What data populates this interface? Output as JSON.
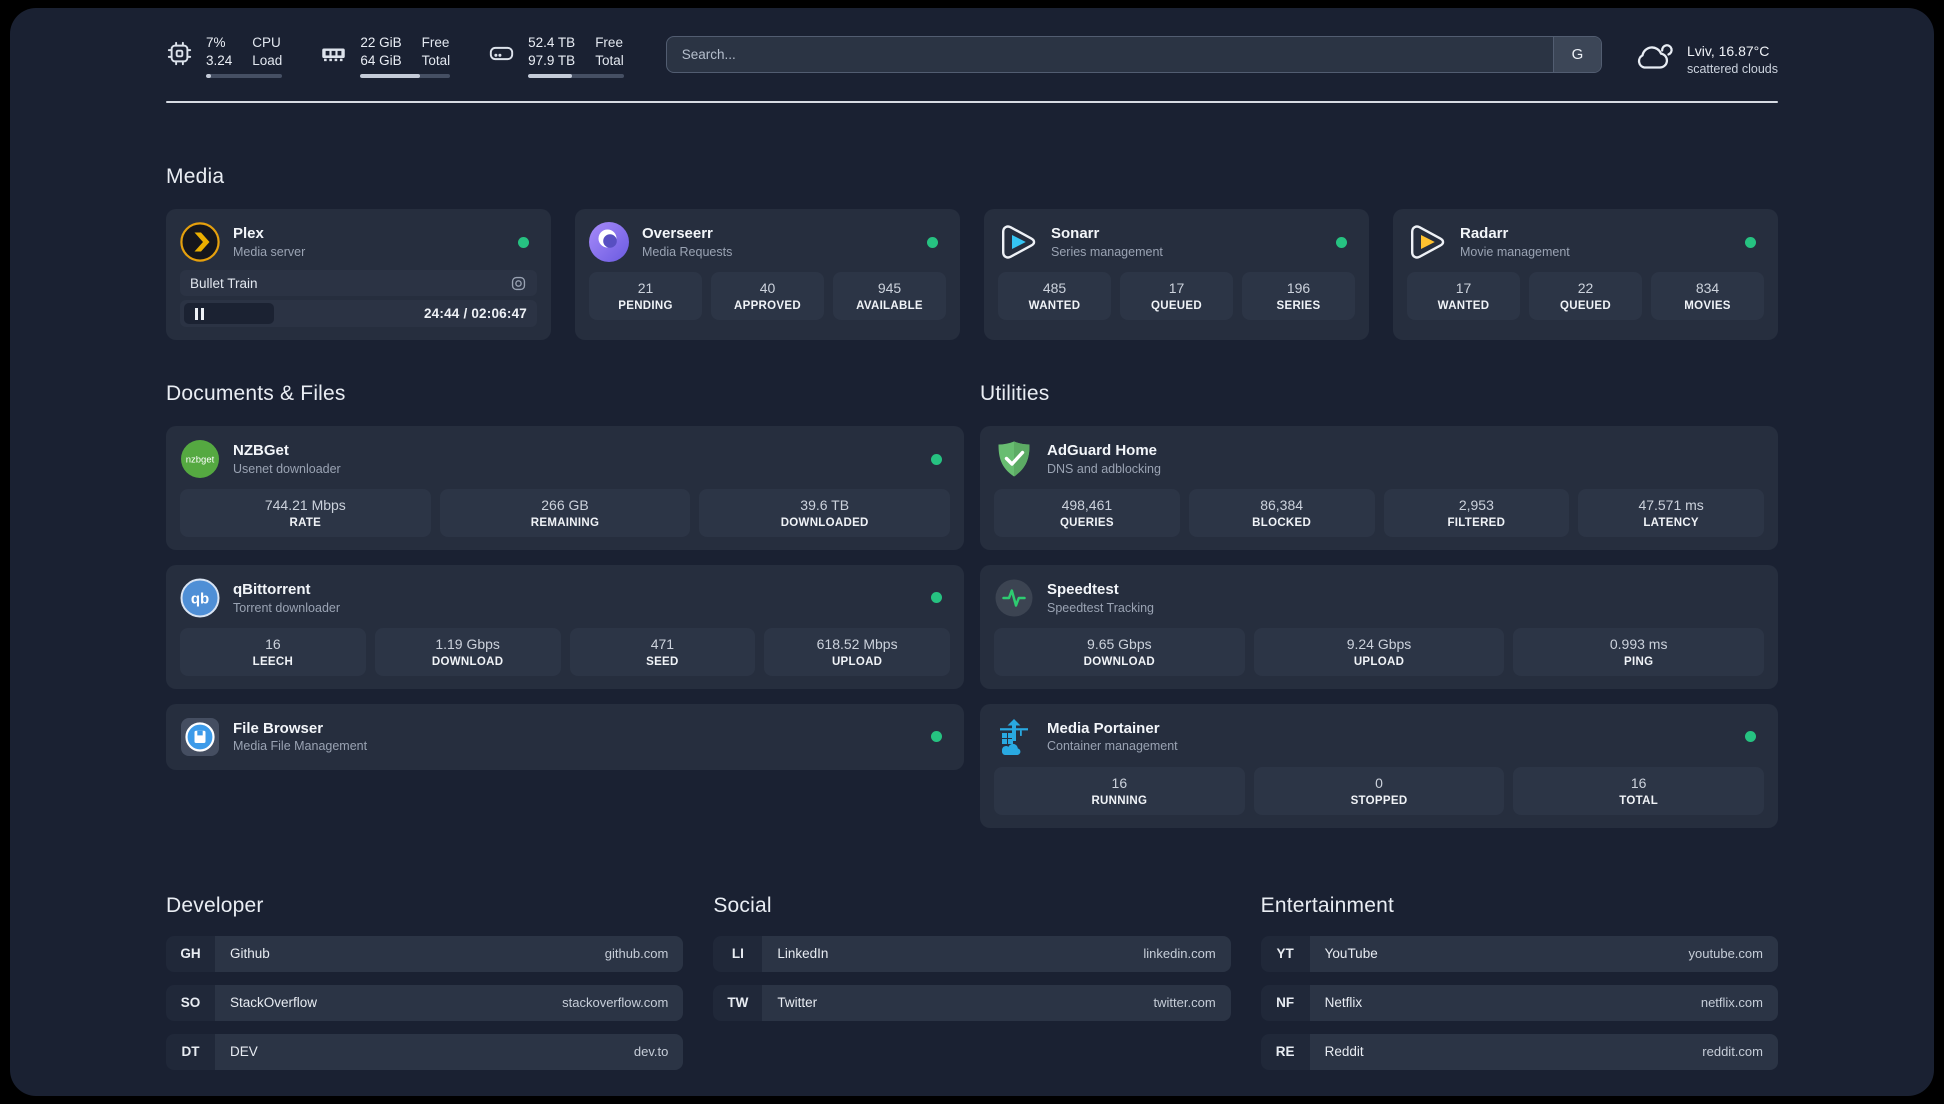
{
  "topbar": {
    "cpu": {
      "percent": "7%",
      "load": "3.24",
      "label_top": "CPU",
      "label_bottom": "Load",
      "bar_style": "width:7%"
    },
    "memory": {
      "free": "22 GiB",
      "total": "64 GiB",
      "label_top": "Free",
      "label_bottom": "Total",
      "bar_style": "width:66%"
    },
    "disk": {
      "free": "52.4 TB",
      "total": "97.9 TB",
      "label_top": "Free",
      "label_bottom": "Total",
      "bar_style": "width:46%"
    },
    "search": {
      "placeholder": "Search...",
      "engine": "G"
    },
    "weather": {
      "location": "Lviv, 16.87°C",
      "condition": "scattered clouds"
    }
  },
  "media": {
    "title": "Media",
    "plex": {
      "name": "Plex",
      "description": "Media server",
      "now_playing": "Bullet Train",
      "time": "24:44 / 02:06:47"
    },
    "overseerr": {
      "name": "Overseerr",
      "description": "Media Requests",
      "stats": [
        {
          "value": "21",
          "label": "PENDING"
        },
        {
          "value": "40",
          "label": "APPROVED"
        },
        {
          "value": "945",
          "label": "AVAILABLE"
        }
      ]
    },
    "sonarr": {
      "name": "Sonarr",
      "description": "Series management",
      "stats": [
        {
          "value": "485",
          "label": "WANTED"
        },
        {
          "value": "17",
          "label": "QUEUED"
        },
        {
          "value": "196",
          "label": "SERIES"
        }
      ]
    },
    "radarr": {
      "name": "Radarr",
      "description": "Movie management",
      "stats": [
        {
          "value": "17",
          "label": "WANTED"
        },
        {
          "value": "22",
          "label": "QUEUED"
        },
        {
          "value": "834",
          "label": "MOVIES"
        }
      ]
    }
  },
  "documents": {
    "title": "Documents & Files",
    "nzbget": {
      "name": "NZBGet",
      "description": "Usenet downloader",
      "stats": [
        {
          "value": "744.21 Mbps",
          "label": "RATE"
        },
        {
          "value": "266 GB",
          "label": "REMAINING"
        },
        {
          "value": "39.6 TB",
          "label": "DOWNLOADED"
        }
      ]
    },
    "qbittorrent": {
      "name": "qBittorrent",
      "description": "Torrent downloader",
      "stats": [
        {
          "value": "16",
          "label": "LEECH"
        },
        {
          "value": "1.19 Gbps",
          "label": "DOWNLOAD"
        },
        {
          "value": "471",
          "label": "SEED"
        },
        {
          "value": "618.52 Mbps",
          "label": "UPLOAD"
        }
      ]
    },
    "filebrowser": {
      "name": "File Browser",
      "description": "Media File Management"
    }
  },
  "utilities": {
    "title": "Utilities",
    "adguard": {
      "name": "AdGuard Home",
      "description": "DNS and adblocking",
      "stats": [
        {
          "value": "498,461",
          "label": "QUERIES"
        },
        {
          "value": "86,384",
          "label": "BLOCKED"
        },
        {
          "value": "2,953",
          "label": "FILTERED"
        },
        {
          "value": "47.571 ms",
          "label": "LATENCY"
        }
      ]
    },
    "speedtest": {
      "name": "Speedtest",
      "description": "Speedtest Tracking",
      "stats": [
        {
          "value": "9.65 Gbps",
          "label": "DOWNLOAD"
        },
        {
          "value": "9.24 Gbps",
          "label": "UPLOAD"
        },
        {
          "value": "0.993 ms",
          "label": "PING"
        }
      ]
    },
    "portainer": {
      "name": "Media Portainer",
      "description": "Container management",
      "stats": [
        {
          "value": "16",
          "label": "RUNNING"
        },
        {
          "value": "0",
          "label": "STOPPED"
        },
        {
          "value": "16",
          "label": "TOTAL"
        }
      ]
    }
  },
  "developer": {
    "title": "Developer",
    "links": [
      {
        "abbr": "GH",
        "name": "Github",
        "url": "github.com"
      },
      {
        "abbr": "SO",
        "name": "StackOverflow",
        "url": "stackoverflow.com"
      },
      {
        "abbr": "DT",
        "name": "DEV",
        "url": "dev.to"
      }
    ]
  },
  "social": {
    "title": "Social",
    "links": [
      {
        "abbr": "LI",
        "name": "LinkedIn",
        "url": "linkedin.com"
      },
      {
        "abbr": "TW",
        "name": "Twitter",
        "url": "twitter.com"
      }
    ]
  },
  "entertainment": {
    "title": "Entertainment",
    "links": [
      {
        "abbr": "YT",
        "name": "YouTube",
        "url": "youtube.com"
      },
      {
        "abbr": "NF",
        "name": "Netflix",
        "url": "netflix.com"
      },
      {
        "abbr": "RE",
        "name": "Reddit",
        "url": "reddit.com"
      }
    ]
  },
  "colors": {
    "status_online": "#26c281",
    "background": "#1a2132",
    "card": "#262e3e",
    "plex_accent": "#e5a00d",
    "sonarr_accent": "#35c5f4",
    "radarr_accent": "#ffc230",
    "speedtest_accent": "#2ecc71",
    "portainer_accent": "#29a9e1"
  }
}
